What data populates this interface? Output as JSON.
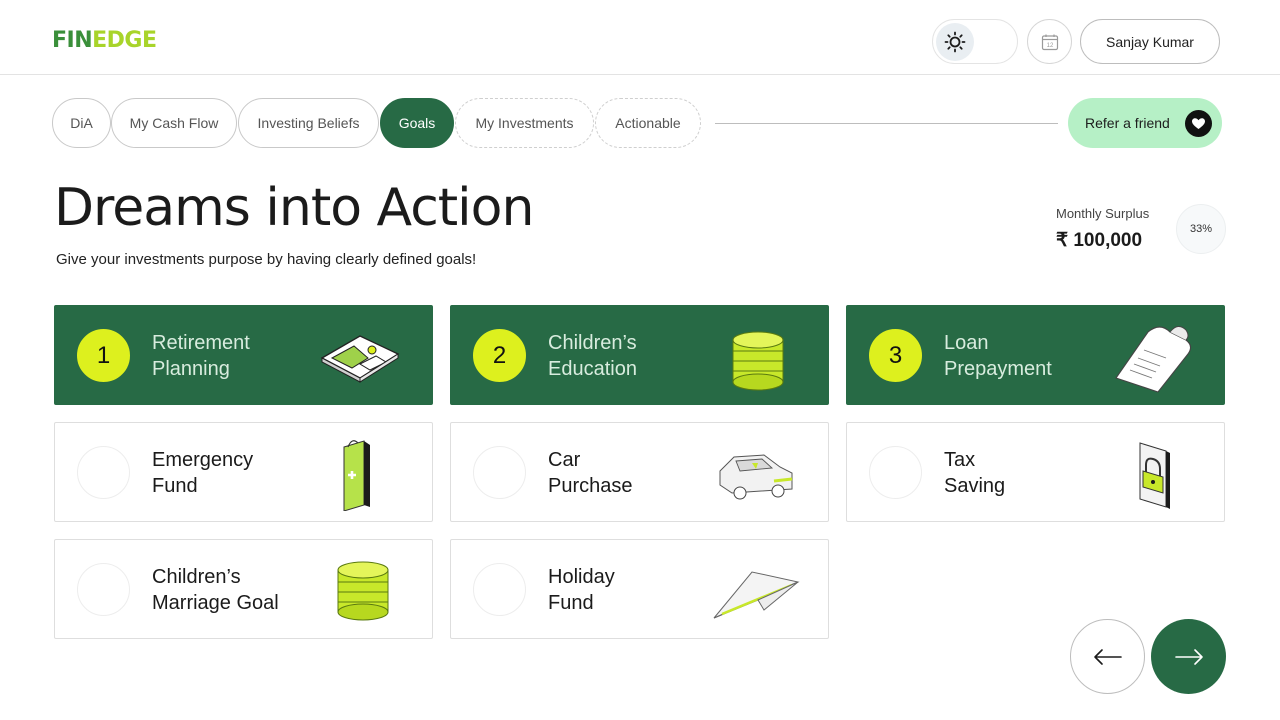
{
  "header": {
    "logo_part1": "FIN",
    "logo_part2": "EDGE",
    "theme_icon": "sun-icon",
    "calendar_icon": "calendar-icon",
    "calendar_day": "12",
    "user_name": "Sanjay Kumar"
  },
  "tabs": [
    {
      "label": "DiA",
      "state": "done"
    },
    {
      "label": "My Cash Flow",
      "state": "done"
    },
    {
      "label": "Investing Beliefs",
      "state": "done"
    },
    {
      "label": "Goals",
      "state": "active"
    },
    {
      "label": "My Investments",
      "state": "pending"
    },
    {
      "label": "Actionable",
      "state": "pending"
    }
  ],
  "refer": {
    "label": "Refer a friend",
    "icon": "heart-chat-icon"
  },
  "page": {
    "title": "Dreams into Action",
    "subtitle": "Give your investments purpose by having clearly defined goals!"
  },
  "surplus": {
    "label": "Monthly Surplus",
    "value": "₹ 100,000",
    "percent": "33%"
  },
  "goals": [
    {
      "label": "Retirement\nPlanning",
      "rank": "1",
      "selected": true,
      "icon": "map-icon"
    },
    {
      "label": "Children’s\nEducation",
      "rank": "2",
      "selected": true,
      "icon": "coins-icon"
    },
    {
      "label": "Loan\nPrepayment",
      "rank": "3",
      "selected": true,
      "icon": "receipt-icon"
    },
    {
      "label": "Emergency\nFund",
      "rank": "",
      "selected": false,
      "icon": "first-aid-kit-icon"
    },
    {
      "label": "Car\nPurchase",
      "rank": "",
      "selected": false,
      "icon": "car-icon"
    },
    {
      "label": "Tax\nSaving",
      "rank": "",
      "selected": false,
      "icon": "lock-icon"
    },
    {
      "label": "Children’s\nMarriage Goal",
      "rank": "",
      "selected": false,
      "icon": "coins-icon"
    },
    {
      "label": "Holiday\nFund",
      "rank": "",
      "selected": false,
      "icon": "paper-plane-icon"
    }
  ],
  "nav": {
    "prev_icon": "arrow-left-icon",
    "next_icon": "arrow-right-icon"
  },
  "colors": {
    "brand_green": "#276a45",
    "accent_lime": "#ddf01e",
    "refer_bg": "#b6f0c6"
  }
}
